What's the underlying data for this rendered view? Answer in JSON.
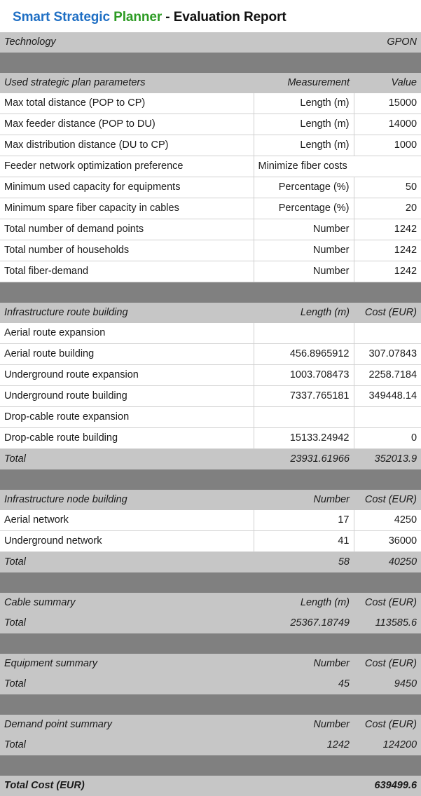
{
  "title": {
    "blue": "Smart Strategic ",
    "green": "Planner",
    "dark": " - Evaluation Report"
  },
  "colors": {
    "title_blue": "#1f6fc4",
    "title_green": "#2c9b23",
    "header_bg": "#c6c6c6",
    "separator": "#808080",
    "grid": "#d0d0d0"
  },
  "technology": {
    "label": "Technology",
    "value": "GPON"
  },
  "sections": [
    {
      "header": {
        "label": "Used strategic plan parameters",
        "mid": "Measurement",
        "right": "Value"
      },
      "rows": [
        {
          "label": "Max total distance (POP to CP)",
          "mid": "Length (m)",
          "right": "15000"
        },
        {
          "label": "Max feeder distance (POP to DU)",
          "mid": "Length (m)",
          "right": "14000"
        },
        {
          "label": "Max distribution distance (DU to CP)",
          "mid": "Length (m)",
          "right": "1000"
        },
        {
          "label": "Feeder network optimization preference",
          "mid": "Minimize fiber costs",
          "right": "",
          "span": true
        },
        {
          "label": "Minimum used capacity for equipments",
          "mid": "Percentage (%)",
          "right": "50"
        },
        {
          "label": "Minimum spare fiber capacity in cables",
          "mid": "Percentage (%)",
          "right": "20"
        },
        {
          "label": "Total number of demand points",
          "mid": "Number",
          "right": "1242"
        },
        {
          "label": "Total number of households",
          "mid": "Number",
          "right": "1242"
        },
        {
          "label": "Total fiber-demand",
          "mid": "Number",
          "right": "1242"
        }
      ],
      "total": null
    },
    {
      "header": {
        "label": "Infrastructure route building",
        "mid": "Length (m)",
        "right": "Cost (EUR)"
      },
      "rows": [
        {
          "label": "Aerial route expansion",
          "mid": "",
          "right": ""
        },
        {
          "label": "Aerial route building",
          "mid": "456.8965912",
          "right": "307.07843"
        },
        {
          "label": "Underground route expansion",
          "mid": "1003.708473",
          "right": "2258.7184"
        },
        {
          "label": "Underground route building",
          "mid": "7337.765181",
          "right": "349448.14"
        },
        {
          "label": "Drop-cable route expansion",
          "mid": "",
          "right": ""
        },
        {
          "label": "Drop-cable route building",
          "mid": "15133.24942",
          "right": "0"
        }
      ],
      "total": {
        "label": "Total",
        "mid": "23931.61966",
        "right": "352013.9"
      }
    },
    {
      "header": {
        "label": "Infrastructure node building",
        "mid": "Number",
        "right": "Cost (EUR)"
      },
      "rows": [
        {
          "label": "Aerial network",
          "mid": "17",
          "right": "4250"
        },
        {
          "label": "Underground network",
          "mid": "41",
          "right": "36000"
        }
      ],
      "total": {
        "label": "Total",
        "mid": "58",
        "right": "40250"
      }
    },
    {
      "header": {
        "label": "Cable summary",
        "mid": "Length (m)",
        "right": "Cost (EUR)"
      },
      "rows": [],
      "total": {
        "label": "Total",
        "mid": "25367.18749",
        "right": "113585.6"
      }
    },
    {
      "header": {
        "label": "Equipment summary",
        "mid": "Number",
        "right": "Cost (EUR)"
      },
      "rows": [],
      "total": {
        "label": "Total",
        "mid": "45",
        "right": "9450"
      }
    },
    {
      "header": {
        "label": "Demand point summary",
        "mid": "Number",
        "right": "Cost (EUR)"
      },
      "rows": [],
      "total": {
        "label": "Total",
        "mid": "1242",
        "right": "124200"
      }
    }
  ],
  "grand_total": {
    "label": "Total Cost (EUR)",
    "mid": "",
    "right": "639499.6"
  }
}
